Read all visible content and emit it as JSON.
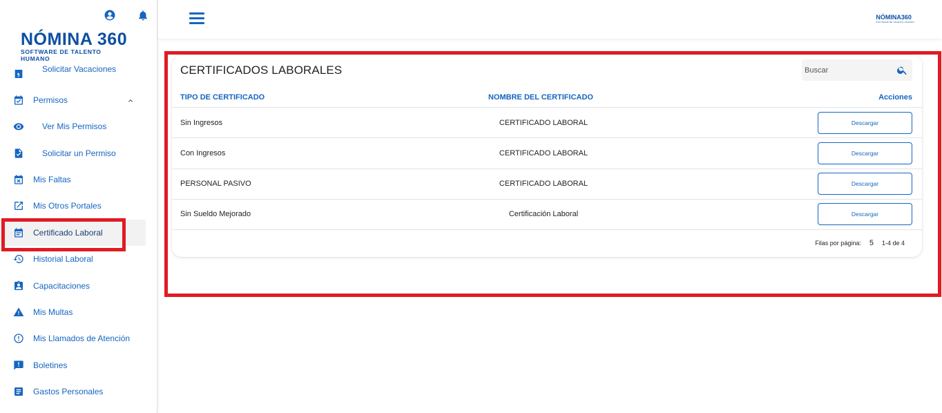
{
  "brand": {
    "name": "NÓMINA 360",
    "tagline": "SOFTWARE DE TALENTO HUMANO"
  },
  "topbar": {
    "logo_small": "NÓMINA360",
    "logo_small_tagline": "SOFTWARE DE TALENTO HUMANO"
  },
  "sidebar": {
    "items": [
      {
        "label": "Solicitar Vacaciones",
        "icon": "dollar-card-icon"
      },
      {
        "label": "Permisos",
        "icon": "calendar-check-icon"
      },
      {
        "label": "Ver Mis Permisos",
        "icon": "eye-icon"
      },
      {
        "label": "Solicitar un Permiso",
        "icon": "document-check-icon"
      },
      {
        "label": "Mis Faltas",
        "icon": "calendar-x-icon"
      },
      {
        "label": "Mis Otros Portales",
        "icon": "external-link-icon"
      },
      {
        "label": "Certificado Laboral",
        "icon": "calendar-list-icon"
      },
      {
        "label": "Historial Laboral",
        "icon": "history-icon"
      },
      {
        "label": "Capacitaciones",
        "icon": "badge-icon"
      },
      {
        "label": "Mis Multas",
        "icon": "warning-icon"
      },
      {
        "label": "Mis Llamados de Atención",
        "icon": "alert-circle-icon"
      },
      {
        "label": "Boletines",
        "icon": "announcement-icon"
      },
      {
        "label": "Gastos Personales",
        "icon": "list-box-icon"
      }
    ]
  },
  "main": {
    "title": "CERTIFICADOS LABORALES",
    "search_placeholder": "Buscar",
    "columns": {
      "type": "TIPO DE CERTIFICADO",
      "name": "NOMBRE DEL CERTIFICADO",
      "actions": "Acciones"
    },
    "rows": [
      {
        "type": "Sin Ingresos",
        "name": "CERTIFICADO LABORAL",
        "action": "Descargar"
      },
      {
        "type": "Con Ingresos",
        "name": "CERTIFICADO LABORAL",
        "action": "Descargar"
      },
      {
        "type": "PERSONAL PASIVO",
        "name": "CERTIFICADO LABORAL",
        "action": "Descargar"
      },
      {
        "type": "Sin Sueldo Mejorado",
        "name": "Certificación Laboral",
        "action": "Descargar"
      }
    ],
    "pagination": {
      "rows_per_page_label": "Filas por página:",
      "rows_per_page": "5",
      "range": "1-4 de 4"
    }
  },
  "colors": {
    "accent": "#1565c0",
    "highlight": "#e01b24"
  }
}
